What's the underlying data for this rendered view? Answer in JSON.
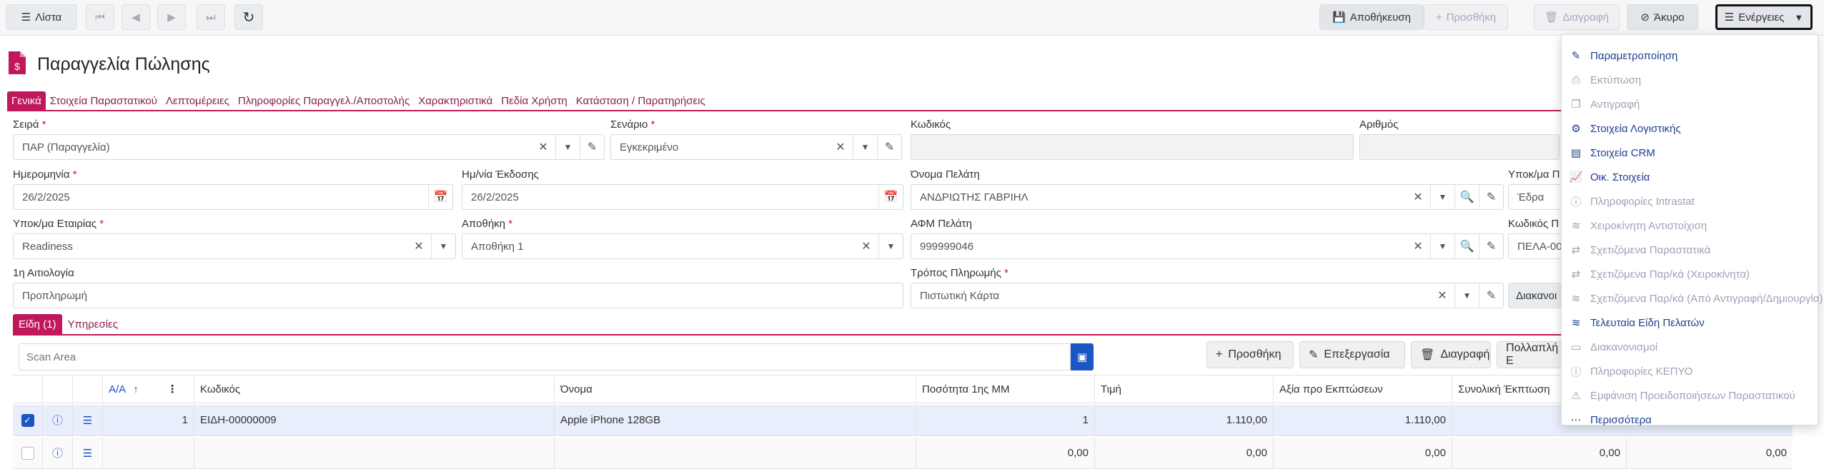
{
  "toolbar": {
    "list_label": "Λίστα",
    "save_label": "Αποθήκευση",
    "add_label": "Προσθήκη",
    "delete_label": "Διαγραφή",
    "cancel_label": "Άκυρο",
    "actions_label": "Ενέργειες"
  },
  "page": {
    "title": "Παραγγελία Πώλησης"
  },
  "tabs": [
    "Γενικά",
    "Στοιχεία Παραστατικού",
    "Λεπτομέρειες",
    "Πληροφορίες Παραγγελ./Αποστολής",
    "Χαρακτηριστικά",
    "Πεδία Χρήστη",
    "Κατάσταση / Παρατηρήσεις"
  ],
  "form": {
    "series": {
      "label": "Σειρά",
      "value": "ΠΑΡ (Παραγγελία)"
    },
    "scenario": {
      "label": "Σενάριο",
      "value": "Εγκεκριμένο"
    },
    "code": {
      "label": "Κωδικός",
      "value": ""
    },
    "number": {
      "label": "Αριθμός",
      "value": ""
    },
    "date": {
      "label": "Ημερομηνία",
      "value": "26/2/2025"
    },
    "issue_date": {
      "label": "Ημ/νία Έκδοσης",
      "value": "26/2/2025"
    },
    "customer_name": {
      "label": "Όνομα Πελάτη",
      "value": "ΑΝΔΡΙΩΤΗΣ ΓΑΒΡΙΗΛ"
    },
    "customer_branch": {
      "label": "Υποκ/μα Π",
      "value": "Έδρα"
    },
    "company_branch": {
      "label": "Υποκ/μα Εταιρίας",
      "value": "Readiness"
    },
    "warehouse": {
      "label": "Αποθήκη",
      "value": "Αποθήκη 1"
    },
    "customer_vat": {
      "label": "ΑΦΜ Πελάτη",
      "value": "999999046"
    },
    "customer_code": {
      "label": "Κωδικός Π",
      "value": "ΠΕΛΑ-00"
    },
    "reason": {
      "label": "1η Αιτιολογία",
      "value": "Προπληρωμή"
    },
    "payment": {
      "label": "Τρόπος Πληρωμής",
      "value": "Πιστωτική Κάρτα"
    },
    "shipping_button": "Διακανοι"
  },
  "subtabs": [
    "Είδη (1)",
    "Υπηρεσίες"
  ],
  "grid": {
    "scan_placeholder": "Scan Area",
    "buttons": {
      "add": "Προσθήκη",
      "edit": "Επεξεργασία",
      "delete": "Διαγραφή",
      "multi": "Πολλαπλή Ε"
    },
    "columns": [
      "Α/Α",
      "Κωδικός",
      "Όνομα",
      "Ποσότητα 1ης ΜΜ",
      "Τιμή",
      "Αξία προ Εκπτώσεων",
      "Συνολική Έκπτωση"
    ],
    "rows": [
      {
        "aa": "1",
        "code": "ΕΙΔΗ-00000009",
        "name": "Apple iPhone 128GB",
        "qty": "1",
        "price": "1.110,00",
        "value": "1.110,00",
        "discount": ""
      },
      {
        "aa": "",
        "code": "",
        "name": "",
        "qty": "0,00",
        "price": "0,00",
        "value": "0,00",
        "discount": "0,00"
      }
    ],
    "extra_last": "0,00"
  },
  "actions_menu": [
    {
      "label": "Παραμετροποίηση",
      "icon": "pencil-icon",
      "enabled": true
    },
    {
      "label": "Εκτύπωση",
      "icon": "printer-icon",
      "enabled": false
    },
    {
      "label": "Αντιγραφή",
      "icon": "copy-icon",
      "enabled": false
    },
    {
      "label": "Στοιχεία Λογιστικής",
      "icon": "accounting-icon",
      "enabled": true
    },
    {
      "label": "Στοιχεία CRM",
      "icon": "crm-icon",
      "enabled": true
    },
    {
      "label": "Οικ. Στοιχεία",
      "icon": "chart-icon",
      "enabled": true
    },
    {
      "label": "Πληροφορίες Intrastat",
      "icon": "info-icon",
      "enabled": false
    },
    {
      "label": "Χειροκίνητη Αντιστοίχιση",
      "icon": "layers-icon",
      "enabled": false
    },
    {
      "label": "Σχετιζόμενα Παραστατικά",
      "icon": "exchange-icon",
      "enabled": false
    },
    {
      "label": "Σχετιζόμενα Παρ/κά (Χειροκίνητα)",
      "icon": "exchange-icon",
      "enabled": false
    },
    {
      "label": "Σχετιζόμενα Παρ/κά (Από Αντιγραφή/Δημιουργία)",
      "icon": "layers-icon",
      "enabled": false
    },
    {
      "label": "Τελευταία Είδη Πελατών",
      "icon": "layers-icon",
      "enabled": true
    },
    {
      "label": "Διακανονισμοί",
      "icon": "card-icon",
      "enabled": false
    },
    {
      "label": "Πληροφορίες ΚΕΠΥΟ",
      "icon": "info-icon",
      "enabled": false
    },
    {
      "label": "Εμφάνιση Προειδοποιήσεων Παραστατικού",
      "icon": "warning-icon",
      "enabled": false
    },
    {
      "label": "Περισσότερα",
      "icon": "more-icon",
      "enabled": true
    }
  ],
  "colors": {
    "accent": "#c0185a",
    "link": "#1d3f8f",
    "scan_button": "#1a56c4",
    "selected_row": "#e8eefb"
  }
}
